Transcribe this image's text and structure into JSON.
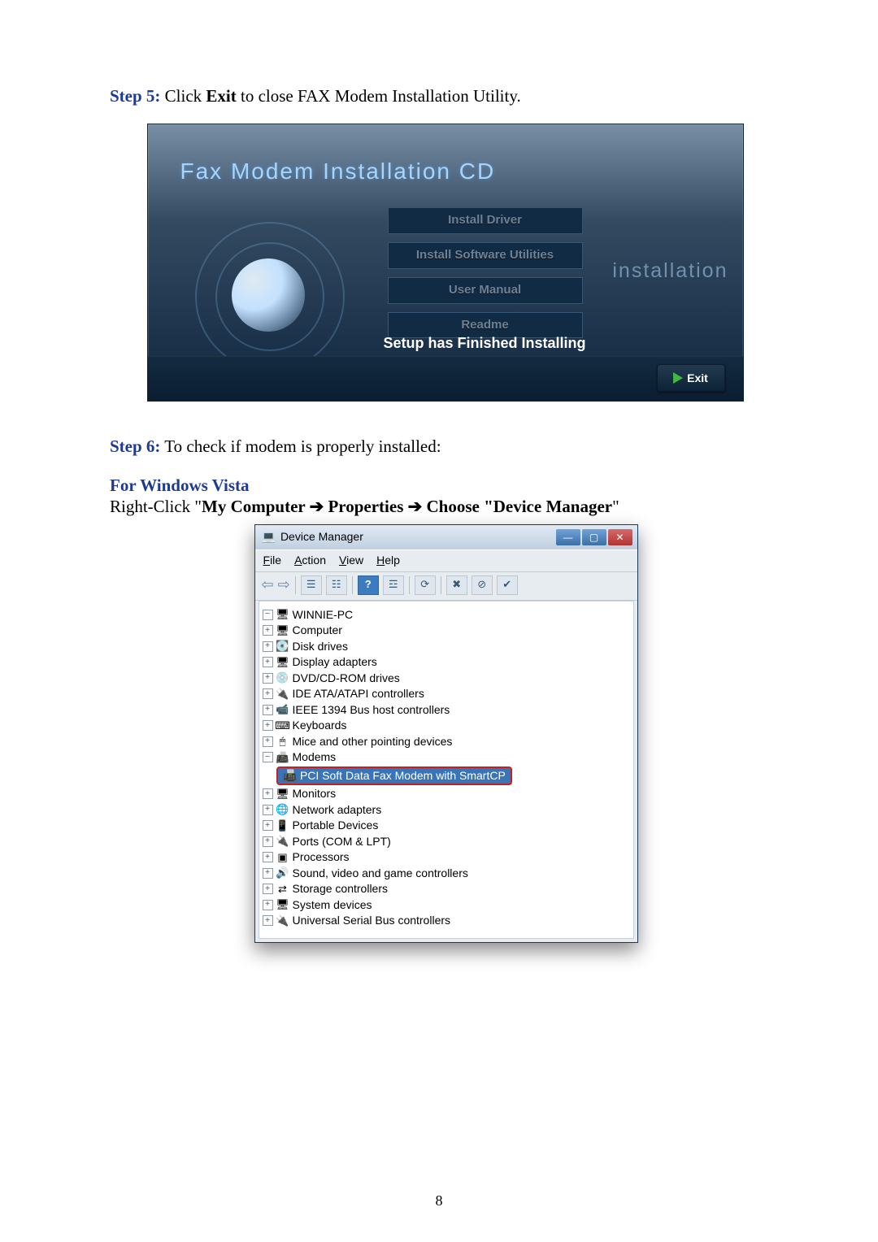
{
  "step5": {
    "label": "Step 5:",
    "text_a": " Click ",
    "text_b": "Exit",
    "text_c": " to close FAX Modem Installation Utility."
  },
  "installer": {
    "title": "Fax Modem Installation CD",
    "buttons": [
      "Install Driver",
      "Install Software Utilities",
      "User Manual",
      "Readme"
    ],
    "watermark": "installation",
    "status": "Setup has Finished Installing",
    "exit": "Exit"
  },
  "step6": {
    "label": "Step 6:",
    "text": " To check if modem is properly installed:",
    "os_heading": "For Windows Vista",
    "path_a": "Right-Click \"",
    "path_b": "My Computer ",
    "path_c": " Properties ",
    "path_d": " Choose \"Device Manager",
    "path_e": "\""
  },
  "arrow": "➔",
  "devmgr": {
    "title": "Device Manager",
    "menu": {
      "file": "File",
      "action": "Action",
      "view": "View",
      "help": "Help"
    },
    "root": "WINNIE-PC",
    "items": [
      {
        "expand": "+",
        "icon": "🖥",
        "label": "Computer"
      },
      {
        "expand": "+",
        "icon": "💽",
        "label": "Disk drives"
      },
      {
        "expand": "+",
        "icon": "🖥",
        "label": "Display adapters"
      },
      {
        "expand": "+",
        "icon": "💿",
        "label": "DVD/CD-ROM drives"
      },
      {
        "expand": "+",
        "icon": "🔌",
        "label": "IDE ATA/ATAPI controllers"
      },
      {
        "expand": "+",
        "icon": "📹",
        "label": "IEEE 1394 Bus host controllers"
      },
      {
        "expand": "+",
        "icon": "⌨",
        "label": "Keyboards"
      },
      {
        "expand": "+",
        "icon": "🖱",
        "label": "Mice and other pointing devices"
      },
      {
        "expand": "−",
        "icon": "📠",
        "label": "Modems"
      },
      {
        "expand": "+",
        "icon": "🖥",
        "label": "Monitors"
      },
      {
        "expand": "+",
        "icon": "🌐",
        "label": "Network adapters"
      },
      {
        "expand": "+",
        "icon": "📱",
        "label": "Portable Devices"
      },
      {
        "expand": "+",
        "icon": "🔌",
        "label": "Ports (COM & LPT)"
      },
      {
        "expand": "+",
        "icon": "▣",
        "label": "Processors"
      },
      {
        "expand": "+",
        "icon": "🔊",
        "label": "Sound, video and game controllers"
      },
      {
        "expand": "+",
        "icon": "⇄",
        "label": "Storage controllers"
      },
      {
        "expand": "+",
        "icon": "🖥",
        "label": "System devices"
      },
      {
        "expand": "+",
        "icon": "🔌",
        "label": "Universal Serial Bus controllers"
      }
    ],
    "highlighted": {
      "icon": "📠",
      "label": "PCI Soft Data Fax Modem with SmartCP"
    }
  },
  "page_number": "8"
}
